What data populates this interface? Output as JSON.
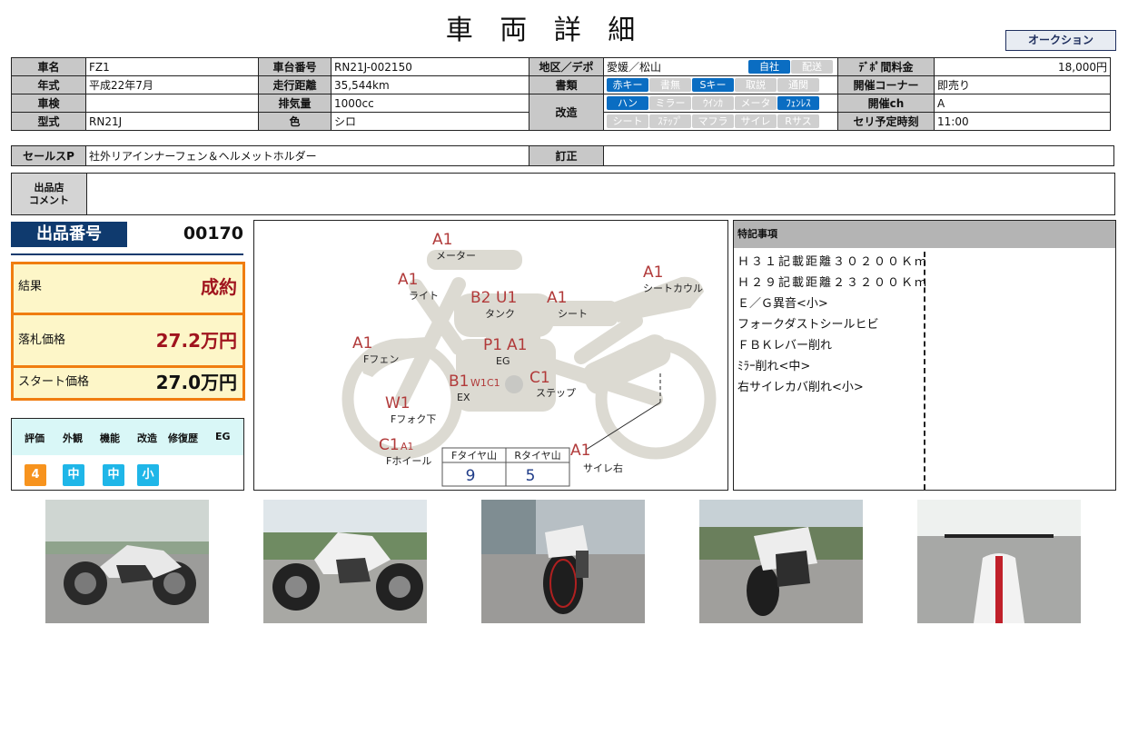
{
  "title": "車 両 詳 細",
  "auction_button": "オークション",
  "spec": {
    "name_label": "車名",
    "name": "FZ1",
    "frame_label": "車台番号",
    "frame": "RN21J-002150",
    "area_label": "地区／デポ",
    "area": "愛媛／松山",
    "area_tags": [
      {
        "label": "自社",
        "on": true
      },
      {
        "label": "配送",
        "on": false
      }
    ],
    "depo_fee_label": "ﾃﾞﾎﾟ間料金",
    "depo_fee": "18,000円",
    "year_label": "年式",
    "year": "平成22年7月",
    "mileage_label": "走行距離",
    "mileage": "35,544km",
    "docs_label": "書類",
    "doc_tags": [
      {
        "label": "赤キー",
        "on": true
      },
      {
        "label": "書無",
        "on": false
      },
      {
        "label": "Sキー",
        "on": true
      },
      {
        "label": "取説",
        "on": false
      },
      {
        "label": "通関",
        "on": false
      }
    ],
    "corner_label": "開催コーナー",
    "corner": "即売り",
    "inspection_label": "車検",
    "inspection": "",
    "displacement_label": "排気量",
    "displacement": "1000cc",
    "mod_label": "改造",
    "mod_tags_row1": [
      {
        "label": "ハン",
        "on": true
      },
      {
        "label": "ミラー",
        "on": false
      },
      {
        "label": "ｳｲﾝｶ",
        "on": false
      },
      {
        "label": "メータ",
        "on": false
      },
      {
        "label": "ﾌｪﾝﾚｽ",
        "on": true
      }
    ],
    "mod_tags_row2": [
      {
        "label": "シート",
        "on": false
      },
      {
        "label": "ｽﾃｯﾌﾟ",
        "on": false
      },
      {
        "label": "マフラ",
        "on": false
      },
      {
        "label": "サイレ",
        "on": false
      },
      {
        "label": "Rサス",
        "on": false
      }
    ],
    "channel_label": "開催ch",
    "channel": "A",
    "model_label": "型式",
    "model": "RN21J",
    "color_label": "色",
    "color": "シロ",
    "time_label": "セリ予定時刻",
    "time": "11:00"
  },
  "sales": {
    "label": "セールスP",
    "value": "社外リアインナーフェン＆ヘルメットホルダー",
    "correction_label": "訂正",
    "correction": ""
  },
  "comment": {
    "label_line1": "出品店",
    "label_line2": "コメント",
    "value": ""
  },
  "lot": {
    "label": "出品番号",
    "number": "00170"
  },
  "result": {
    "result_label": "結果",
    "result": "成約",
    "sold_label": "落札価格",
    "sold": "27.2万円",
    "start_label": "スタート価格",
    "start": "27.0万円"
  },
  "evaluation": {
    "headers": [
      "評価",
      "外観",
      "機能",
      "改造",
      "修復歴",
      "EG"
    ],
    "values": [
      {
        "v": "4",
        "color": "#f7931e"
      },
      {
        "v": "中",
        "color": "#1fb6e8"
      },
      {
        "v": "中",
        "color": "#1fb6e8"
      },
      {
        "v": "小",
        "color": "#1fb6e8"
      }
    ]
  },
  "diagram": {
    "marks": {
      "meter": "A1",
      "meter_lbl": "メーター",
      "light": "A1",
      "light_lbl": "ライト",
      "tank_b": "B2",
      "tank_u": "U1",
      "tank_lbl": "タンク",
      "seat": "A1",
      "seat_lbl": "シート",
      "cowl": "A1",
      "cowl_lbl": "シートカウル",
      "ffen": "A1",
      "ffen_lbl": "Fフェン",
      "eg_p": "P1",
      "eg_a": "A1",
      "eg_lbl": "EG",
      "ex_b": "B1",
      "ex_w": "W1",
      "ex_c": "C1",
      "ex_lbl": "EX",
      "step": "C1",
      "step_lbl": "ステップ",
      "fork": "W1",
      "fork_lbl": "Fフォク下",
      "wheel_c": "C1",
      "wheel_a": "A1",
      "wheel_lbl": "Fホイール",
      "silencer": "A1",
      "silencer_lbl": "サイレ右"
    },
    "tires": {
      "front_label": "Fタイヤ山",
      "front": "9",
      "rear_label": "Rタイヤ山",
      "rear": "5"
    }
  },
  "notes": {
    "header": "特記事項",
    "items": [
      "Ｈ３１記載距離３０２００Ｋｍ",
      "Ｈ２９記載距離２３２００Ｋｍ",
      "Ｅ／Ｇ異音<小>",
      "フォークダストシールヒビ",
      "ＦＢＫレバー削れ",
      "ﾐﾗｰ削れ<中>",
      "右サイレカバ削れ<小>"
    ]
  }
}
